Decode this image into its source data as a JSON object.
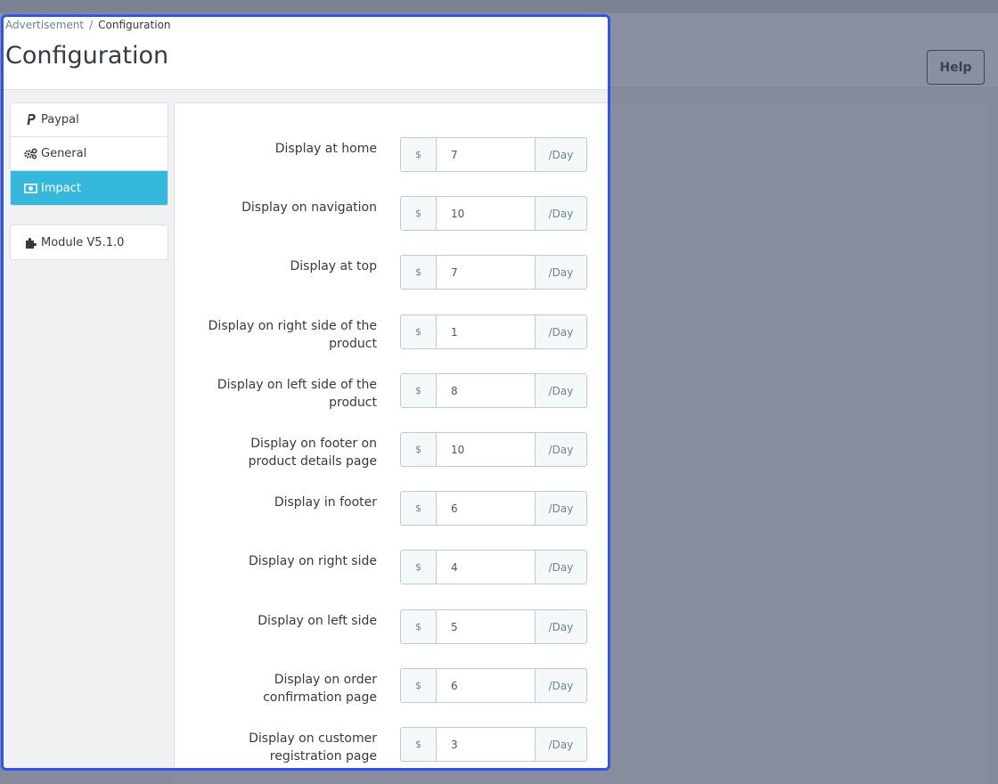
{
  "background": {
    "help_label": "Help"
  },
  "breadcrumb": {
    "parent": "Advertisement",
    "separator": "/",
    "current": "Configuration"
  },
  "page_title": "Configuration",
  "sidebar": {
    "items": [
      {
        "label": "Paypal",
        "icon": "paypal-icon",
        "active": false
      },
      {
        "label": "General",
        "icon": "gears-icon",
        "active": false
      },
      {
        "label": "Impact",
        "icon": "money-icon",
        "active": true
      }
    ],
    "module": {
      "label": "Module V5.1.0",
      "icon": "puzzle-icon"
    }
  },
  "form": {
    "currency": "$",
    "unit": "/Day",
    "fields": [
      {
        "label": "Display at home",
        "value": "7"
      },
      {
        "label": "Display on navigation",
        "value": "10"
      },
      {
        "label": "Display at top",
        "value": "7"
      },
      {
        "label": "Display on right side of the product",
        "value": "1"
      },
      {
        "label": "Display on left side of the product",
        "value": "8"
      },
      {
        "label": "Display on footer on product details page",
        "value": "10"
      },
      {
        "label": "Display in footer",
        "value": "6"
      },
      {
        "label": "Display on right side",
        "value": "4"
      },
      {
        "label": "Display on left side",
        "value": "5"
      },
      {
        "label": "Display on order confirmation page",
        "value": "6"
      },
      {
        "label": "Display on customer registration page",
        "value": "3"
      }
    ]
  },
  "colors": {
    "accent": "#35b8dc",
    "highlight_border": "#2f54eb",
    "overlay": "#858b9a"
  }
}
